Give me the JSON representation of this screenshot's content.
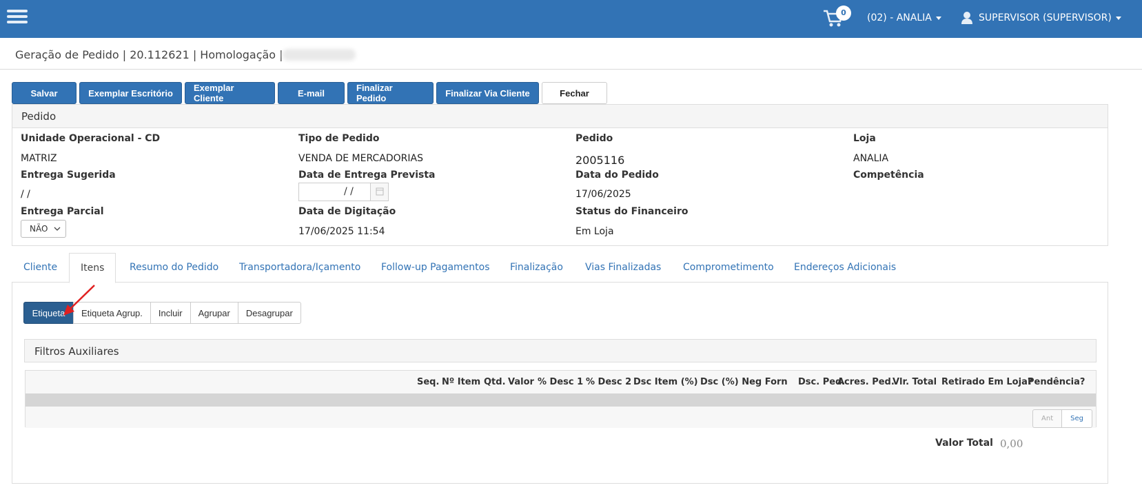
{
  "header": {
    "cart_count": "0",
    "store_selector": "(02) - ANALIA",
    "user_menu": "SUPERVISOR (SUPERVISOR)"
  },
  "breadcrumb": {
    "text": "Geração de Pedido | 20.112621 | Homologação |"
  },
  "toolbar": {
    "save": "Salvar",
    "office_copy": "Exemplar Escritório",
    "client_copy": "Exemplar Cliente",
    "email": "E-mail",
    "finalize_order": "Finalizar Pedido",
    "finalize_client": "Finalizar Via Cliente",
    "close": "Fechar"
  },
  "pedido": {
    "title": "Pedido",
    "unidade_label": "Unidade Operacional - CD",
    "unidade_value": "MATRIZ",
    "tipo_label": "Tipo de Pedido",
    "tipo_value": "VENDA DE MERCADORIAS",
    "pedido_label": "Pedido",
    "pedido_value": "2005116",
    "loja_label": "Loja",
    "loja_value": "ANALIA",
    "entrega_sugerida_label": "Entrega Sugerida",
    "entrega_sugerida_value": "/ /",
    "data_entrega_label": "Data de Entrega Prevista",
    "data_entrega_value": "/ /",
    "data_pedido_label": "Data do Pedido",
    "data_pedido_value": "17/06/2025",
    "competencia_label": "Competência",
    "entrega_parcial_label": "Entrega Parcial",
    "entrega_parcial_value": "NÃO",
    "data_digitacao_label": "Data de Digitação",
    "data_digitacao_value": "17/06/2025 11:54",
    "status_label": "Status do Financeiro",
    "status_value": "Em Loja"
  },
  "tabs": [
    {
      "label": "Cliente"
    },
    {
      "label": "Itens"
    },
    {
      "label": "Resumo do Pedido"
    },
    {
      "label": "Transportadora/Içamento"
    },
    {
      "label": "Follow-up Pagamentos"
    },
    {
      "label": "Finalização"
    },
    {
      "label": "Vias Finalizadas"
    },
    {
      "label": "Comprometimento"
    },
    {
      "label": "Endereços Adicionais"
    }
  ],
  "itens": {
    "buttons": {
      "etiqueta": "Etiqueta",
      "etiqueta_agrup": "Etiqueta Agrup.",
      "incluir": "Incluir",
      "agrupar": "Agrupar",
      "desagrupar": "Desagrupar"
    },
    "filters_title": "Filtros Auxiliares",
    "columns": [
      "Seq.",
      "Nº Item",
      "Qtd.",
      "Valor",
      "% Desc 1",
      "% Desc 2",
      "Dsc Item (%)",
      "Dsc (%) Neg Forn",
      "Dsc. Ped.",
      "Acres. Ped.",
      "Vlr. Total",
      "Retirado Em Loja?",
      "Pendência?"
    ],
    "pager": {
      "prev": "Ant",
      "next": "Seg"
    },
    "total_label": "Valor Total",
    "total_value": "0,00"
  },
  "colors": {
    "brand": "#3273b5",
    "active_button": "#2b5f91",
    "annotation_arrow": "#e02020"
  }
}
